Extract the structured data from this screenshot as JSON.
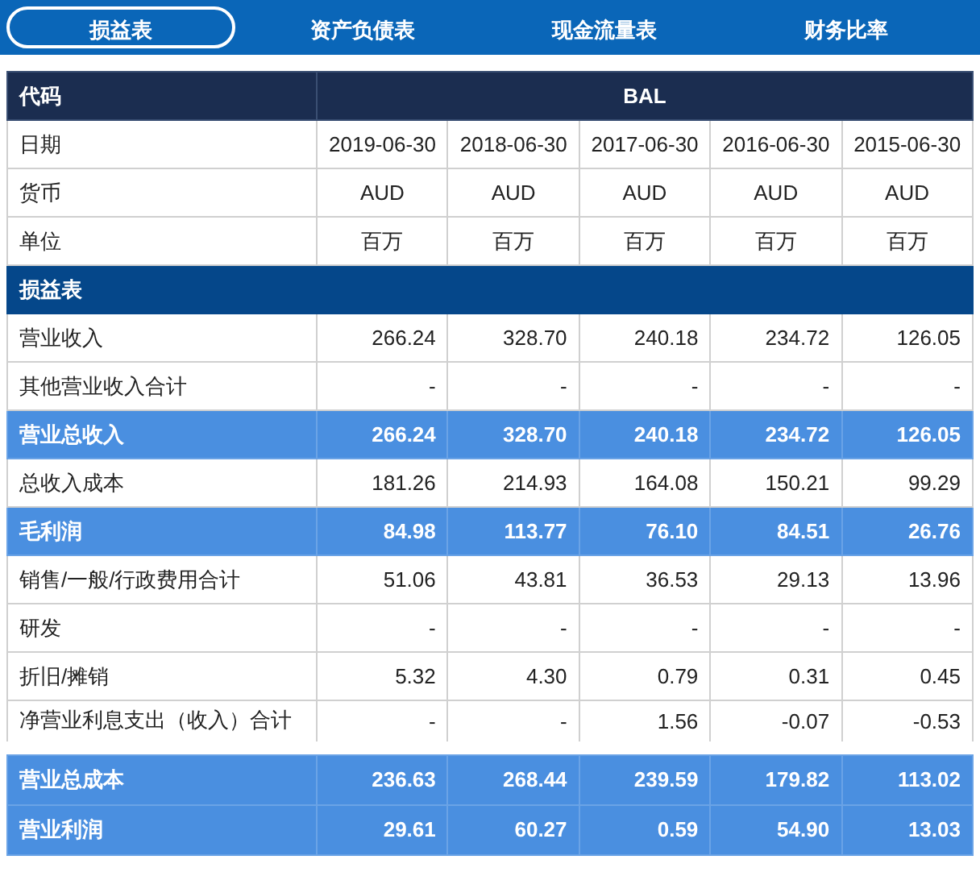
{
  "tabs": [
    {
      "label": "损益表",
      "selected": true
    },
    {
      "label": "资产负债表",
      "selected": false
    },
    {
      "label": "现金流量表",
      "selected": false
    },
    {
      "label": "财务比率",
      "selected": false
    }
  ],
  "table": {
    "header": {
      "label": "代码",
      "value": "BAL"
    },
    "rows": [
      {
        "kind": "info",
        "label": "日期",
        "cells": [
          "2019-06-30",
          "2018-06-30",
          "2017-06-30",
          "2016-06-30",
          "2015-06-30"
        ]
      },
      {
        "kind": "info",
        "label": "货币",
        "cells": [
          "AUD",
          "AUD",
          "AUD",
          "AUD",
          "AUD"
        ]
      },
      {
        "kind": "info",
        "label": "单位",
        "cells": [
          "百万",
          "百万",
          "百万",
          "百万",
          "百万"
        ]
      },
      {
        "kind": "section",
        "label": "损益表"
      },
      {
        "kind": "data",
        "label": "营业收入",
        "cells": [
          "266.24",
          "328.70",
          "240.18",
          "234.72",
          "126.05"
        ]
      },
      {
        "kind": "data",
        "label": "其他营业收入合计",
        "cells": [
          "-",
          "-",
          "-",
          "-",
          "-"
        ]
      },
      {
        "kind": "total",
        "label": "营业总收入",
        "cells": [
          "266.24",
          "328.70",
          "240.18",
          "234.72",
          "126.05"
        ]
      },
      {
        "kind": "data",
        "label": "总收入成本",
        "cells": [
          "181.26",
          "214.93",
          "164.08",
          "150.21",
          "99.29"
        ]
      },
      {
        "kind": "total",
        "label": "毛利润",
        "cells": [
          "84.98",
          "113.77",
          "76.10",
          "84.51",
          "26.76"
        ]
      },
      {
        "kind": "data",
        "label": "销售/一般/行政费用合计",
        "cells": [
          "51.06",
          "43.81",
          "36.53",
          "29.13",
          "13.96"
        ]
      },
      {
        "kind": "data",
        "label": "研发",
        "cells": [
          "-",
          "-",
          "-",
          "-",
          "-"
        ]
      },
      {
        "kind": "data",
        "label": "折旧/摊销",
        "cells": [
          "5.32",
          "4.30",
          "0.79",
          "0.31",
          "0.45"
        ]
      },
      {
        "kind": "data",
        "label": "净营业利息支出（收入）合计",
        "cells": [
          "-",
          "-",
          "1.56",
          "-0.07",
          "-0.53"
        ]
      }
    ],
    "pinned_rows": [
      {
        "kind": "total",
        "label": "营业总成本",
        "cells": [
          "236.63",
          "268.44",
          "239.59",
          "179.82",
          "113.02"
        ]
      },
      {
        "kind": "total",
        "label": "营业利润",
        "cells": [
          "29.61",
          "60.27",
          "0.59",
          "54.90",
          "13.03"
        ]
      }
    ]
  }
}
